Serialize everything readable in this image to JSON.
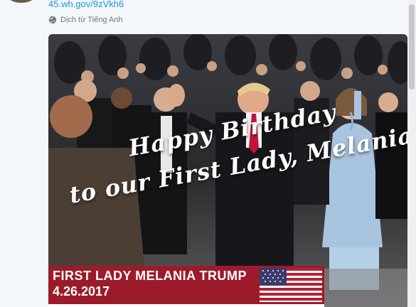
{
  "tweet": {
    "link": "45.wh.gov/9zVkh6",
    "translate_label": "Dịch từ Tiếng Anh"
  },
  "media": {
    "greeting_line1": "Happy Birthday",
    "greeting_line2": "to our First Lady, Melania!",
    "banner_title": "FIRST LADY MELANIA TRUMP",
    "banner_date": "4.26.2017"
  },
  "colors": {
    "link": "#1b95e0",
    "banner": "#9c1b2a"
  },
  "icons": {
    "translate": "globe-icon",
    "flag": "us-flag-icon"
  }
}
